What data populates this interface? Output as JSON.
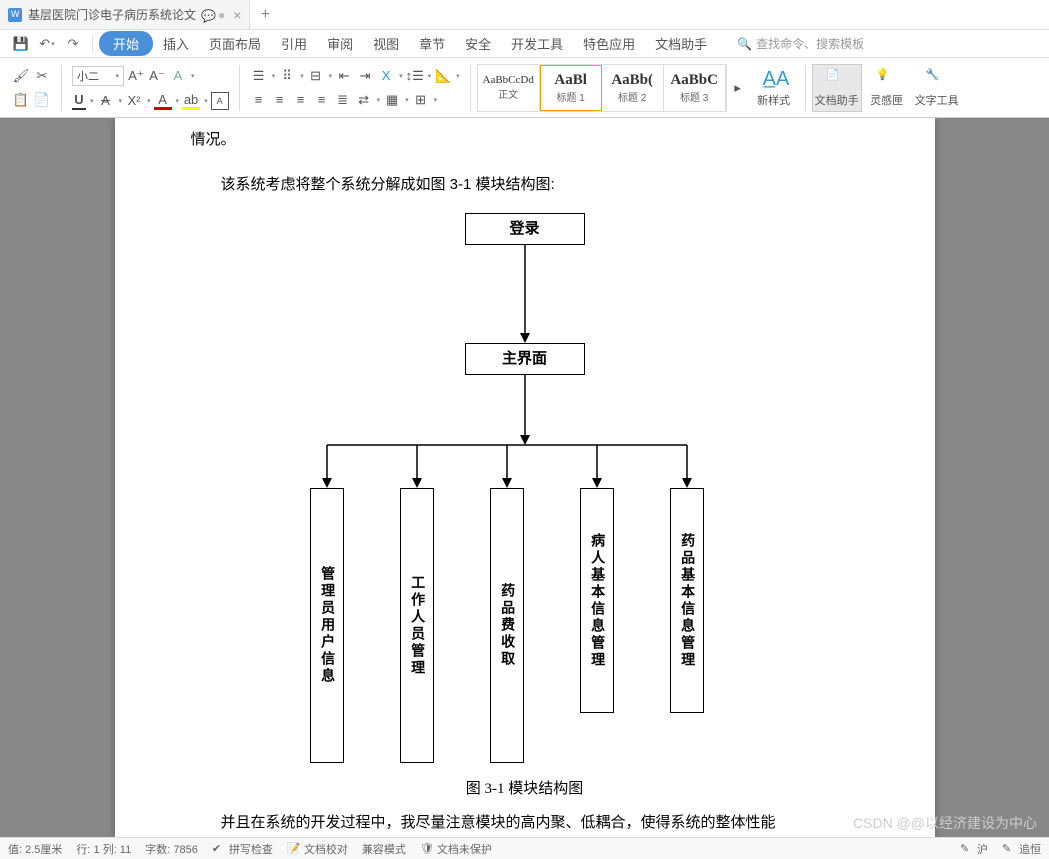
{
  "tab": {
    "title": "基层医院门诊电子病历系统论文"
  },
  "menu": {
    "start": "开始",
    "insert": "插入",
    "layout": "页面布局",
    "reference": "引用",
    "review": "审阅",
    "view": "视图",
    "section": "章节",
    "security": "安全",
    "devtools": "开发工具",
    "special": "特色应用",
    "dochelper": "文档助手"
  },
  "search": {
    "placeholder": "查找命令、搜索模板"
  },
  "toolbar": {
    "fontsize": "小二"
  },
  "styles": {
    "s1": {
      "preview": "AaBbCcDd",
      "name": "正文"
    },
    "s2": {
      "preview": "AaBl",
      "name": "标题 1"
    },
    "s3": {
      "preview": "AaBb(",
      "name": "标题 2"
    },
    "s4": {
      "preview": "AaBbC",
      "name": "标题 3"
    }
  },
  "rightbtns": {
    "newstyle": "新样式",
    "dochelper": "文档助手",
    "inspire": "灵感匣",
    "texttool": "文字工具"
  },
  "doc": {
    "frag_top": "情况。",
    "para1": "该系统考虑将整个系统分解成如图 3-1 模块结构图:",
    "box_login": "登录",
    "box_main": "主界面",
    "box1": "管理员用户信息",
    "box2": "工作人员管理",
    "box3": "药品费收取",
    "box4": "病人基本信息管理",
    "box5": "药品基本信息管理",
    "caption": "图 3-1 模块结构图",
    "frag_bottom": "并且在系统的开发过程中，我尽量注意模块的高内聚、低耦合，使得系统的整体性能"
  },
  "watermark": "CSDN @@以经济建设为中心",
  "status": {
    "pos": "值: 2.5厘米",
    "line": "行: 1  列: 11",
    "words": "字数: 7856",
    "spell": "拼写检查",
    "proof": "文档校对",
    "compat": "兼容模式",
    "protect": "文档未保护",
    "track_label": "沪",
    "track_word": "追恒"
  }
}
